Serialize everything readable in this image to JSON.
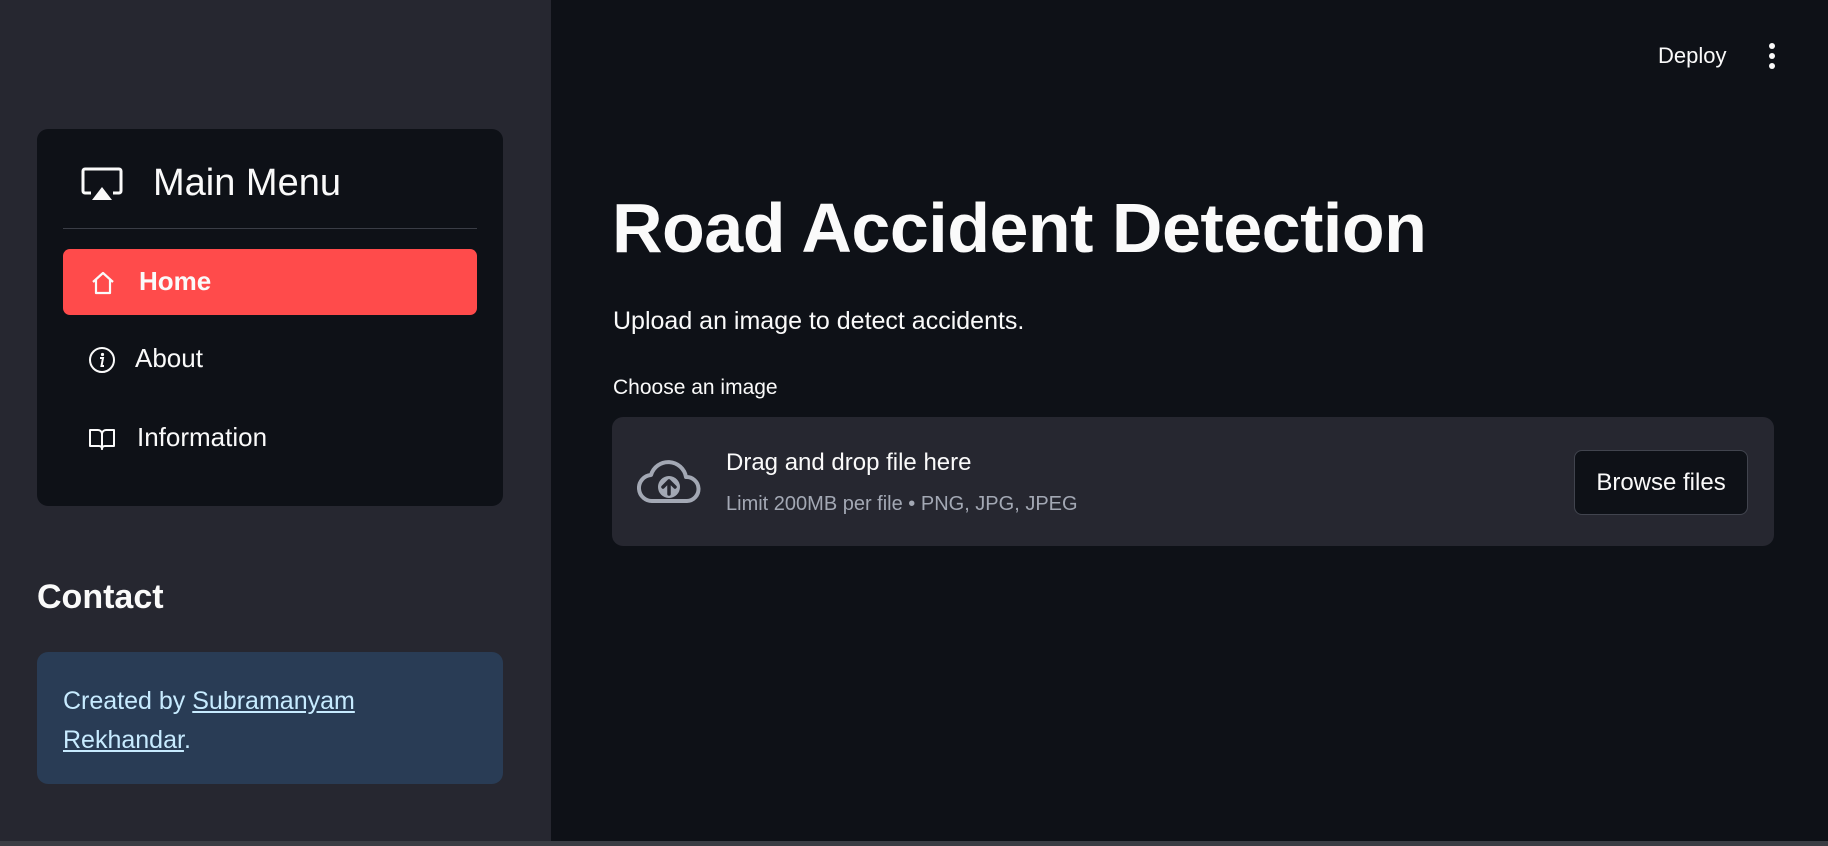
{
  "header": {
    "deploy_label": "Deploy"
  },
  "sidebar": {
    "menu_title": "Main Menu",
    "items": [
      {
        "label": "Home",
        "icon": "home-icon",
        "active": true
      },
      {
        "label": "About",
        "icon": "info-icon",
        "active": false
      },
      {
        "label": "Information",
        "icon": "book-icon",
        "active": false
      }
    ],
    "contact": {
      "title": "Contact",
      "prefix": "Created by ",
      "link_line1": "Subramanyam",
      "link_line2": "Rekhandar",
      "suffix": "."
    }
  },
  "main": {
    "title": "Road Accident Detection",
    "subtitle": "Upload an image to detect accidents.",
    "uploader": {
      "label": "Choose an image",
      "drop_text": "Drag and drop file here",
      "limit_text": "Limit 200MB per file • PNG, JPG, JPEG",
      "browse_label": "Browse files"
    }
  },
  "colors": {
    "accent": "#ff4b4b",
    "background": "#0e1117",
    "sidebar": "#262730",
    "contact_box": "#293c55"
  }
}
